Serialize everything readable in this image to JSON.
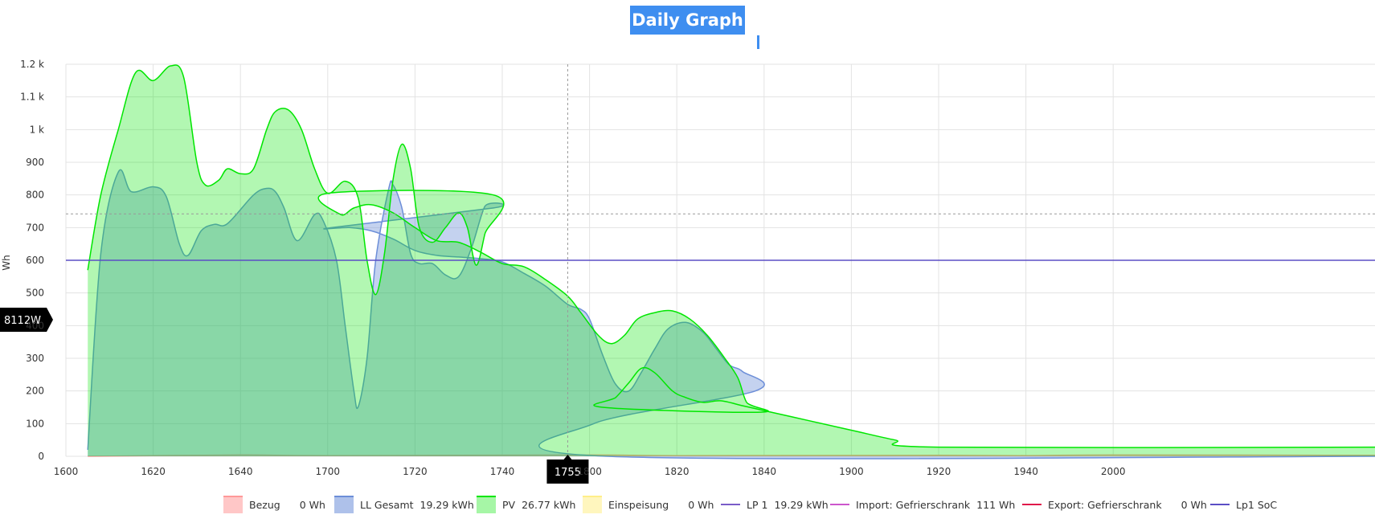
{
  "chart_data": {
    "type": "area",
    "title": "Daily Graph",
    "ylabel": "Wh",
    "xlabel": "",
    "xlim": [
      1600,
      2060
    ],
    "ylim": [
      0,
      1200
    ],
    "x_ticks": [
      "1600",
      "1620",
      "1640",
      "1700",
      "1720",
      "1740",
      "1800",
      "1820",
      "1840",
      "1900",
      "1920",
      "1940",
      "2000"
    ],
    "y_ticks": [
      "0",
      "100",
      "200",
      "300",
      "400",
      "500",
      "600",
      "700",
      "800",
      "900",
      "1 k",
      "1.1 k",
      "1.2 k"
    ],
    "grid": true,
    "legend_position": "bottom",
    "crosshair": {
      "x_label": "1755",
      "y_label": "8112W",
      "y_value": 742
    },
    "series": [
      {
        "name": "Bezug",
        "total": "0 Wh",
        "color": "#ff9999",
        "kind": "area",
        "points": [
          [
            1605,
            0
          ],
          [
            1640,
            4
          ],
          [
            1700,
            2
          ],
          [
            1760,
            4
          ],
          [
            1820,
            2
          ],
          [
            1880,
            3
          ],
          [
            1940,
            2
          ],
          [
            2000,
            4
          ],
          [
            2060,
            3
          ]
        ]
      },
      {
        "name": "LL Gesamt",
        "total": "19.29 kWh",
        "color": "#6c8ed8",
        "kind": "area",
        "points": [
          [
            1605,
            20
          ],
          [
            1608,
            620
          ],
          [
            1612,
            870
          ],
          [
            1615,
            810
          ],
          [
            1620,
            825
          ],
          [
            1623,
            795
          ],
          [
            1626,
            650
          ],
          [
            1628,
            615
          ],
          [
            1631,
            690
          ],
          [
            1634,
            710
          ],
          [
            1637,
            712
          ],
          [
            1643,
            800
          ],
          [
            1646,
            820
          ],
          [
            1648,
            810
          ],
          [
            1650,
            760
          ],
          [
            1653,
            660
          ],
          [
            1657,
            740
          ],
          [
            1659,
            720
          ],
          [
            1662,
            600
          ],
          [
            1664,
            400
          ],
          [
            1666,
            200
          ],
          [
            1667,
            152
          ],
          [
            1669,
            300
          ],
          [
            1671,
            600
          ],
          [
            1674,
            820
          ],
          [
            1675,
            830
          ],
          [
            1677,
            760
          ],
          [
            1679,
            620
          ],
          [
            1681,
            590
          ],
          [
            1684,
            590
          ],
          [
            1687,
            555
          ],
          [
            1690,
            550
          ],
          [
            1693,
            640
          ],
          [
            1696,
            765
          ],
          [
            1698,
            760
          ],
          [
            1701,
            700
          ],
          [
            1705,
            700
          ],
          [
            1710,
            690
          ],
          [
            1715,
            665
          ],
          [
            1720,
            630
          ],
          [
            1725,
            615
          ],
          [
            1730,
            610
          ],
          [
            1735,
            605
          ],
          [
            1740,
            595
          ],
          [
            1745,
            560
          ],
          [
            1750,
            520
          ],
          [
            1755,
            465
          ],
          [
            1758,
            450
          ],
          [
            1760,
            420
          ],
          [
            1763,
            310
          ],
          [
            1766,
            220
          ],
          [
            1769,
            200
          ],
          [
            1772,
            260
          ],
          [
            1775,
            330
          ],
          [
            1778,
            390
          ],
          [
            1782,
            410
          ],
          [
            1786,
            380
          ],
          [
            1789,
            330
          ],
          [
            1792,
            280
          ],
          [
            1795,
            260
          ],
          [
            1798,
            200
          ],
          [
            1801,
            100
          ],
          [
            1804,
            0
          ],
          [
            2060,
            0
          ]
        ]
      },
      {
        "name": "PV",
        "total": "26.77 kWh",
        "color": "#00e600",
        "kind": "area",
        "points": [
          [
            1605,
            570
          ],
          [
            1608,
            800
          ],
          [
            1612,
            1000
          ],
          [
            1616,
            1175
          ],
          [
            1620,
            1150
          ],
          [
            1624,
            1195
          ],
          [
            1627,
            1160
          ],
          [
            1630,
            900
          ],
          [
            1632,
            830
          ],
          [
            1635,
            845
          ],
          [
            1637,
            880
          ],
          [
            1640,
            865
          ],
          [
            1643,
            880
          ],
          [
            1646,
            1000
          ],
          [
            1648,
            1055
          ],
          [
            1651,
            1060
          ],
          [
            1654,
            1000
          ],
          [
            1657,
            880
          ],
          [
            1660,
            805
          ],
          [
            1664,
            842
          ],
          [
            1667,
            790
          ],
          [
            1669,
            600
          ],
          [
            1671,
            495
          ],
          [
            1673,
            620
          ],
          [
            1675,
            850
          ],
          [
            1677,
            955
          ],
          [
            1679,
            880
          ],
          [
            1681,
            700
          ],
          [
            1684,
            655
          ],
          [
            1687,
            700
          ],
          [
            1690,
            745
          ],
          [
            1692,
            700
          ],
          [
            1694,
            585
          ],
          [
            1696,
            680
          ],
          [
            1698,
            800
          ],
          [
            1700,
            805
          ],
          [
            1703,
            740
          ],
          [
            1706,
            760
          ],
          [
            1710,
            770
          ],
          [
            1715,
            745
          ],
          [
            1720,
            700
          ],
          [
            1725,
            660
          ],
          [
            1730,
            655
          ],
          [
            1735,
            625
          ],
          [
            1740,
            590
          ],
          [
            1745,
            580
          ],
          [
            1750,
            540
          ],
          [
            1755,
            490
          ],
          [
            1758,
            440
          ],
          [
            1762,
            370
          ],
          [
            1765,
            345
          ],
          [
            1768,
            370
          ],
          [
            1771,
            420
          ],
          [
            1775,
            440
          ],
          [
            1779,
            445
          ],
          [
            1783,
            420
          ],
          [
            1787,
            370
          ],
          [
            1791,
            300
          ],
          [
            1794,
            240
          ],
          [
            1796,
            165
          ],
          [
            1799,
            135
          ],
          [
            1803,
            150
          ],
          [
            1806,
            180
          ],
          [
            1809,
            225
          ],
          [
            1812,
            270
          ],
          [
            1815,
            255
          ],
          [
            1819,
            200
          ],
          [
            1822,
            180
          ],
          [
            1826,
            165
          ],
          [
            1830,
            170
          ],
          [
            1835,
            155
          ],
          [
            1840,
            140
          ],
          [
            1850,
            110
          ],
          [
            1860,
            80
          ],
          [
            1870,
            50
          ],
          [
            1880,
            28
          ],
          [
            2060,
            28
          ]
        ]
      },
      {
        "name": "Einspeisung",
        "total": "0 Wh",
        "color": "#ffee88",
        "kind": "area",
        "points": []
      },
      {
        "name": "LP 1",
        "total": "19.29 kWh",
        "color": "#7a5cc8",
        "kind": "line",
        "points": []
      },
      {
        "name": "Import: Gefrierschrank",
        "total": "111 Wh",
        "color": "#cc55cc",
        "kind": "line",
        "points": []
      },
      {
        "name": "Export: Gefrierschrank",
        "total": "0 Wh",
        "color": "#e0194b",
        "kind": "line",
        "points": []
      },
      {
        "name": "Lp1 SoC",
        "total": "",
        "color": "#5b4ec5",
        "kind": "line",
        "points": [
          [
            1600,
            600
          ],
          [
            2060,
            600
          ]
        ]
      }
    ]
  }
}
